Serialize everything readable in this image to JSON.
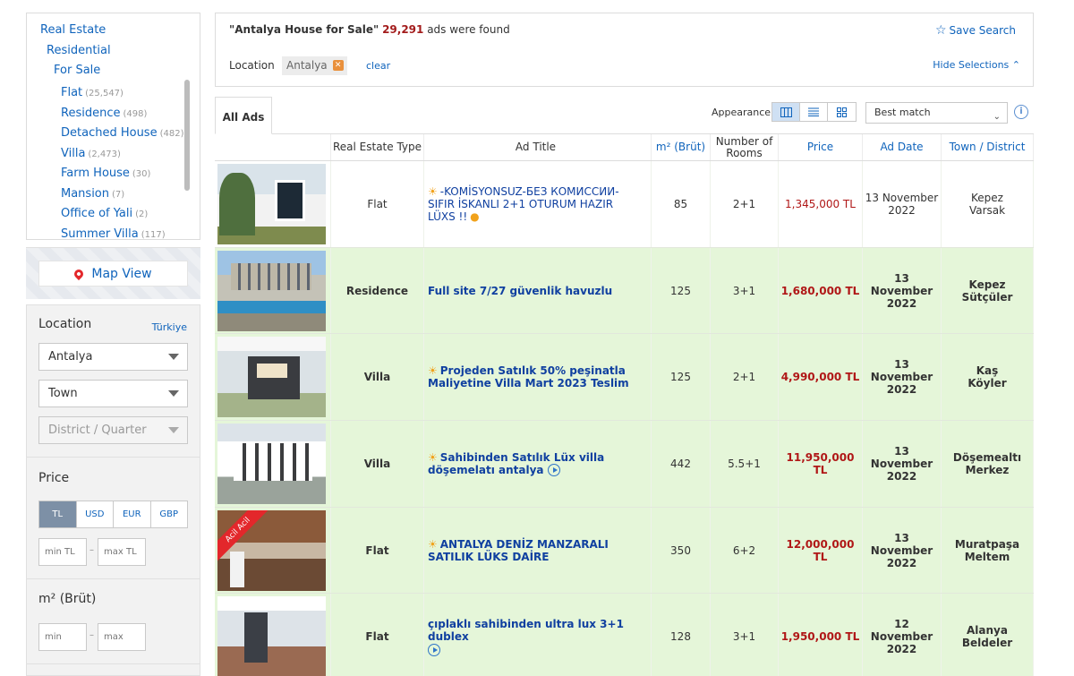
{
  "categories": {
    "level0": "Real Estate",
    "level1": "Residential",
    "level2": "For Sale",
    "items": [
      {
        "label": "Flat",
        "count": "(25,547)"
      },
      {
        "label": "Residence",
        "count": "(498)"
      },
      {
        "label": "Detached House",
        "count": "(482)"
      },
      {
        "label": "Villa",
        "count": "(2,473)"
      },
      {
        "label": "Farm House",
        "count": "(30)"
      },
      {
        "label": "Mansion",
        "count": "(7)"
      },
      {
        "label": "Office of Yali",
        "count": "(2)"
      },
      {
        "label": "Summer Villa",
        "count": "(117)"
      }
    ]
  },
  "map": {
    "label": "Map View"
  },
  "filters": {
    "location_heading": "Location",
    "country": "Türkiye",
    "city": "Antalya",
    "town": "Town",
    "district": "District / Quarter",
    "price_heading": "Price",
    "currencies": [
      "TL",
      "USD",
      "EUR",
      "GBP"
    ],
    "price_min_placeholder": "min TL",
    "price_max_placeholder": "max TL",
    "dash": "–",
    "m2_heading": "m² (Brüt)",
    "m2_min_placeholder": "min",
    "m2_max_placeholder": "max"
  },
  "search": {
    "query": "\"Antalya House for Sale\"",
    "count": "29,291",
    "suffix": "ads were found",
    "save_label": "Save Search",
    "location_label": "Location",
    "location_chip": "Antalya",
    "clear_label": "clear",
    "hide_selections": "Hide Selections"
  },
  "toolbar": {
    "tab_all": "All Ads",
    "appearance": "Appearance",
    "sort_value": "Best match"
  },
  "table": {
    "headers": {
      "type": "Real Estate Type",
      "title": "Ad Title",
      "m2": "m² (Brüt)",
      "rooms": "Number of Rooms",
      "price": "Price",
      "date": "Ad Date",
      "town": "Town / District"
    },
    "rows": [
      {
        "type": "Flat",
        "title": "-KOMİSYONSUZ-БЕЗ КОМИССИИ-SIFIR İSKANLI 2+1 OTURUM HAZIR LÜXS !!",
        "m2": "85",
        "rooms": "2+1",
        "price": "1,345,000 TL",
        "date": "13 November 2022",
        "town1": "Kepez",
        "town2": "Varsak"
      },
      {
        "type": "Residence",
        "title": "Full site 7/27 güvenlik havuzlu",
        "m2": "125",
        "rooms": "3+1",
        "price": "1,680,000 TL",
        "date": "13 November 2022",
        "town1": "Kepez",
        "town2": "Sütçüler"
      },
      {
        "type": "Villa",
        "title": "Projeden Satılık 50% peşinatla Maliyetine Villa Mart 2023 Teslim",
        "m2": "125",
        "rooms": "2+1",
        "price": "4,990,000 TL",
        "date": "13 November 2022",
        "town1": "Kaş",
        "town2": "Köyler"
      },
      {
        "type": "Villa",
        "title": "Sahibinden Satılık Lüx villa döşemelatı antalya",
        "m2": "442",
        "rooms": "5.5+1",
        "price": "11,950,000 TL",
        "date": "13 November 2022",
        "town1": "Döşemealtı",
        "town2": "Merkez"
      },
      {
        "type": "Flat",
        "title": "ANTALYA DENİZ MANZARALI SATILIK LÜKS DAİRE",
        "m2": "350",
        "rooms": "6+2",
        "price": "12,000,000 TL",
        "date": "13 November 2022",
        "town1": "Muratpaşa",
        "town2": "Meltem",
        "ribbon": "Acil Acil"
      },
      {
        "type": "Flat",
        "title": "çıplaklı sahibinden ultra lux 3+1 dublex",
        "m2": "128",
        "rooms": "3+1",
        "price": "1,950,000 TL",
        "date": "12 November 2022",
        "town1": "Alanya",
        "town2": "Beldeler"
      }
    ]
  },
  "colors": {
    "link": "#1064bc",
    "price": "#b01717",
    "highlight_row": "#e5f6d9",
    "accent": "#e3272b"
  }
}
